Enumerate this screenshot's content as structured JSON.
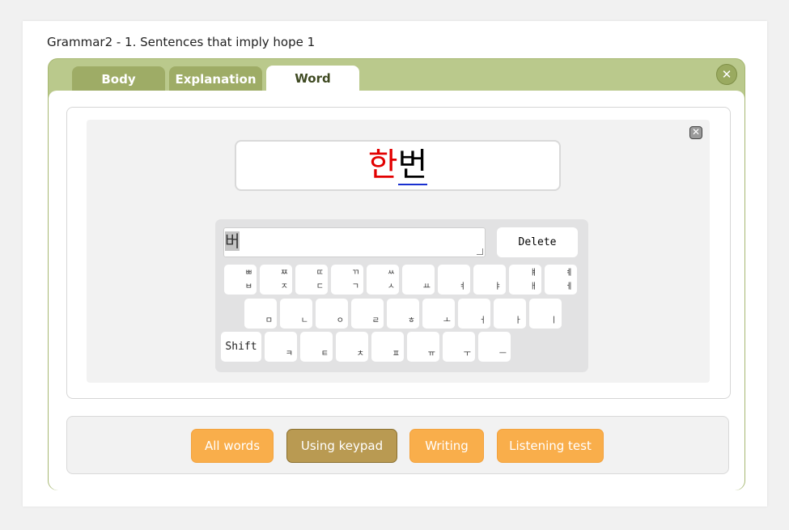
{
  "page": {
    "title": "Grammar2 - 1. Sentences that imply hope 1"
  },
  "tabs": [
    {
      "label": "Body",
      "active": false
    },
    {
      "label": "Explanation",
      "active": false
    },
    {
      "label": "Word",
      "active": true
    }
  ],
  "icons": {
    "panel_close": "close-icon",
    "word_close": "close-icon"
  },
  "word": {
    "completed": "한",
    "current": "번"
  },
  "keypad": {
    "input_value": "버",
    "delete_label": "Delete",
    "shift_label": "Shift",
    "row1": [
      {
        "top": "ㅃ",
        "bottom": "ㅂ"
      },
      {
        "top": "ㅉ",
        "bottom": "ㅈ"
      },
      {
        "top": "ㄸ",
        "bottom": "ㄷ"
      },
      {
        "top": "ㄲ",
        "bottom": "ㄱ"
      },
      {
        "top": "ㅆ",
        "bottom": "ㅅ"
      },
      {
        "top": "",
        "bottom": "ㅛ"
      },
      {
        "top": "",
        "bottom": "ㅕ"
      },
      {
        "top": "",
        "bottom": "ㅑ"
      },
      {
        "top": "ㅒ",
        "bottom": "ㅐ"
      },
      {
        "top": "ㅖ",
        "bottom": "ㅔ"
      }
    ],
    "row2": [
      {
        "bottom": "ㅁ"
      },
      {
        "bottom": "ㄴ"
      },
      {
        "bottom": "ㅇ"
      },
      {
        "bottom": "ㄹ"
      },
      {
        "bottom": "ㅎ"
      },
      {
        "bottom": "ㅗ"
      },
      {
        "bottom": "ㅓ"
      },
      {
        "bottom": "ㅏ"
      },
      {
        "bottom": "ㅣ"
      }
    ],
    "row3": [
      {
        "bottom": "ㅋ"
      },
      {
        "bottom": "ㅌ"
      },
      {
        "bottom": "ㅊ"
      },
      {
        "bottom": "ㅍ"
      },
      {
        "bottom": "ㅠ"
      },
      {
        "bottom": "ㅜ"
      },
      {
        "bottom": "ㅡ"
      }
    ]
  },
  "modes": [
    {
      "label": "All words",
      "active": false
    },
    {
      "label": "Using keypad",
      "active": true
    },
    {
      "label": "Writing",
      "active": false
    },
    {
      "label": "Listening test",
      "active": false
    }
  ],
  "colors": {
    "panel_green": "#bac98c",
    "tab_inactive": "#9eac66",
    "completed_char": "#e20000",
    "mode_orange": "#f9ae4b",
    "mode_active": "#b99a52"
  }
}
